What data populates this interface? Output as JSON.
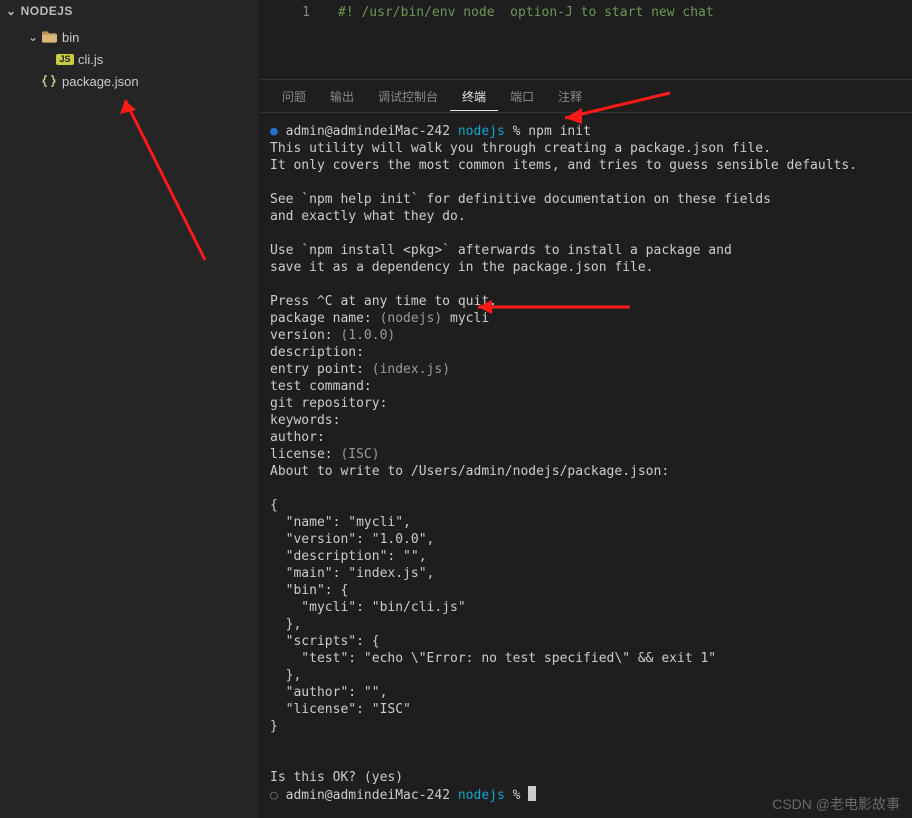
{
  "explorer": {
    "root_label": "NODEJS",
    "items": [
      {
        "type": "folder",
        "label": "bin",
        "expanded": true,
        "depth": 0
      },
      {
        "type": "js",
        "label": "cli.js",
        "depth": 1
      },
      {
        "type": "json",
        "label": "package.json",
        "depth": 0
      }
    ]
  },
  "editor": {
    "line_no": "1",
    "line_text": "#! /usr/bin/env node  option-J to start new chat"
  },
  "panel": {
    "tabs": [
      "问题",
      "输出",
      "调试控制台",
      "终端",
      "端口",
      "注释"
    ],
    "active": 3
  },
  "terminal": {
    "prompt_user": "admin@admindeiMac-242",
    "prompt_dir": "nodejs",
    "prompt_sym": "%",
    "command": "npm init",
    "body": "This utility will walk you through creating a package.json file.\nIt only covers the most common items, and tries to guess sensible defaults.\n\nSee `npm help init` for definitive documentation on these fields\nand exactly what they do.\n\nUse `npm install <pkg>` afterwards to install a package and\nsave it as a dependency in the package.json file.\n\nPress ^C at any time to quit.",
    "qa": [
      {
        "q": "package name: ",
        "hint": "(nodejs)",
        "a": " mycli"
      },
      {
        "q": "version: ",
        "hint": "(1.0.0)",
        "a": ""
      },
      {
        "q": "description: ",
        "hint": "",
        "a": ""
      },
      {
        "q": "entry point: ",
        "hint": "(index.js)",
        "a": ""
      },
      {
        "q": "test command: ",
        "hint": "",
        "a": ""
      },
      {
        "q": "git repository: ",
        "hint": "",
        "a": ""
      },
      {
        "q": "keywords: ",
        "hint": "",
        "a": ""
      },
      {
        "q": "author: ",
        "hint": "",
        "a": ""
      },
      {
        "q": "license: ",
        "hint": "(ISC)",
        "a": ""
      }
    ],
    "about_line": "About to write to /Users/admin/nodejs/package.json:",
    "json_preview": "{\n  \"name\": \"mycli\",\n  \"version\": \"1.0.0\",\n  \"description\": \"\",\n  \"main\": \"index.js\",\n  \"bin\": {\n    \"mycli\": \"bin/cli.js\"\n  },\n  \"scripts\": {\n    \"test\": \"echo \\\"Error: no test specified\\\" && exit 1\"\n  },\n  \"author\": \"\",\n  \"license\": \"ISC\"\n}",
    "confirm": "Is this OK? (yes)"
  },
  "watermark": "CSDN @老电影故事"
}
